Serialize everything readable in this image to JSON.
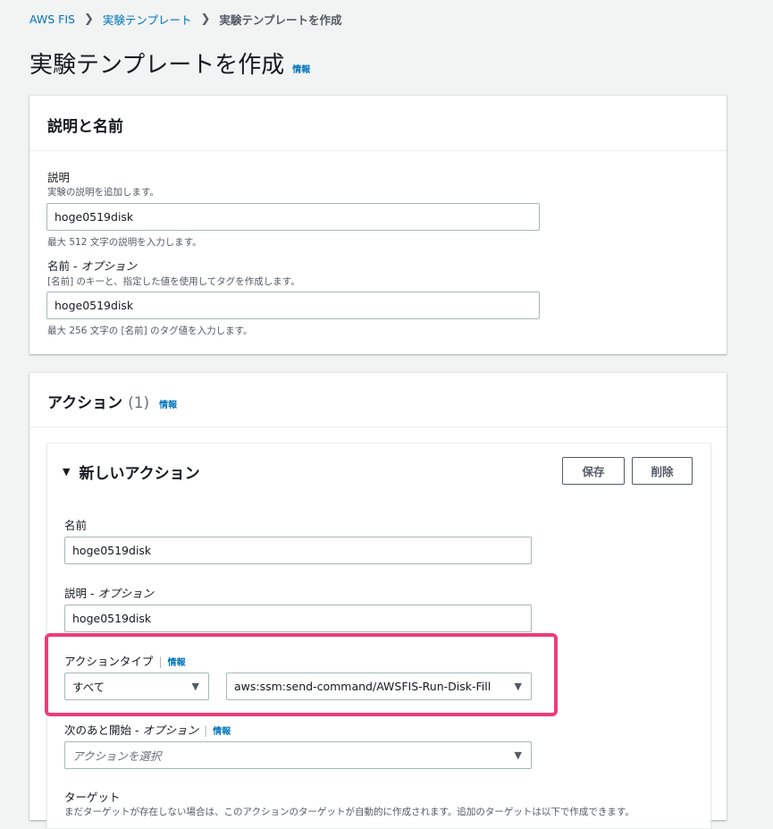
{
  "breadcrumb": {
    "items": [
      "AWS FIS",
      "実験テンプレート"
    ],
    "current": "実験テンプレートを作成"
  },
  "page": {
    "title": "実験テンプレートを作成",
    "info": "情報"
  },
  "desc_panel": {
    "title": "説明と名前",
    "description": {
      "label": "説明",
      "hint": "実験の説明を追加します。",
      "value": "hoge0519disk",
      "constraint": "最大 512 文字の説明を入力します。"
    },
    "name": {
      "label": "名前 - ",
      "optional": "オプション",
      "hint": "[名前] のキーと、指定した値を使用してタグを作成します。",
      "value": "hoge0519disk",
      "constraint": "最大 256 文字の [名前] のタグ値を入力します。"
    }
  },
  "actions_panel": {
    "title": "アクション",
    "count": "(1)",
    "info": "情報",
    "new_action": {
      "title": "新しいアクション",
      "save_button": "保存",
      "delete_button": "削除",
      "name_label": "名前",
      "name_value": "hoge0519disk",
      "desc_label": "説明 - ",
      "desc_optional": "オプション",
      "desc_value": "hoge0519disk",
      "type_label": "アクションタイプ",
      "type_info": "情報",
      "type_filter": "すべて",
      "type_value": "aws:ssm:send-command/AWSFIS-Run-Disk-Fill",
      "start_after_label": "次のあと開始 - ",
      "start_after_optional": "オプション",
      "start_after_info": "情報",
      "start_after_placeholder": "アクションを選択",
      "target_label": "ターゲット",
      "target_hint": "まだターゲットが存在しない場合は、このアクションのターゲットが自動的に作成されます。追加のターゲットは以下で作成できます。"
    }
  },
  "colors": {
    "accent_link": "#0073bb",
    "highlight": "#ec3d76"
  }
}
